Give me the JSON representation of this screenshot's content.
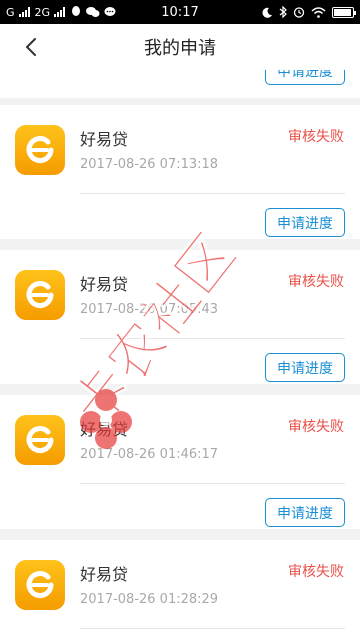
{
  "status_bar": {
    "carrier": "G",
    "network": "2G",
    "time": "10:17",
    "battery_level": 0.85
  },
  "header": {
    "title": "我的申请",
    "back_icon": "chevron-left-icon"
  },
  "partial_item": {
    "button_label": "申请进度"
  },
  "applications": [
    {
      "name": "好易贷",
      "time": "2017-08-26 07:13:18",
      "status": "审核失败",
      "button_label": "申请进度"
    },
    {
      "name": "好易贷",
      "time": "2017-08-26 07:05:43",
      "status": "审核失败",
      "button_label": "申请进度"
    },
    {
      "name": "好易贷",
      "time": "2017-08-26 01:46:17",
      "status": "审核失败",
      "button_label": "申请进度"
    },
    {
      "name": "好易贷",
      "time": "2017-08-26 01:28:29",
      "status": "审核失败"
    }
  ],
  "watermark": "卡农社区",
  "colors": {
    "accent": "#1a8fd6",
    "status_fail": "#e8524a",
    "logo_gradient_top": "#ffc21a",
    "logo_gradient_bottom": "#f59c00",
    "watermark": "#e83a3a"
  }
}
